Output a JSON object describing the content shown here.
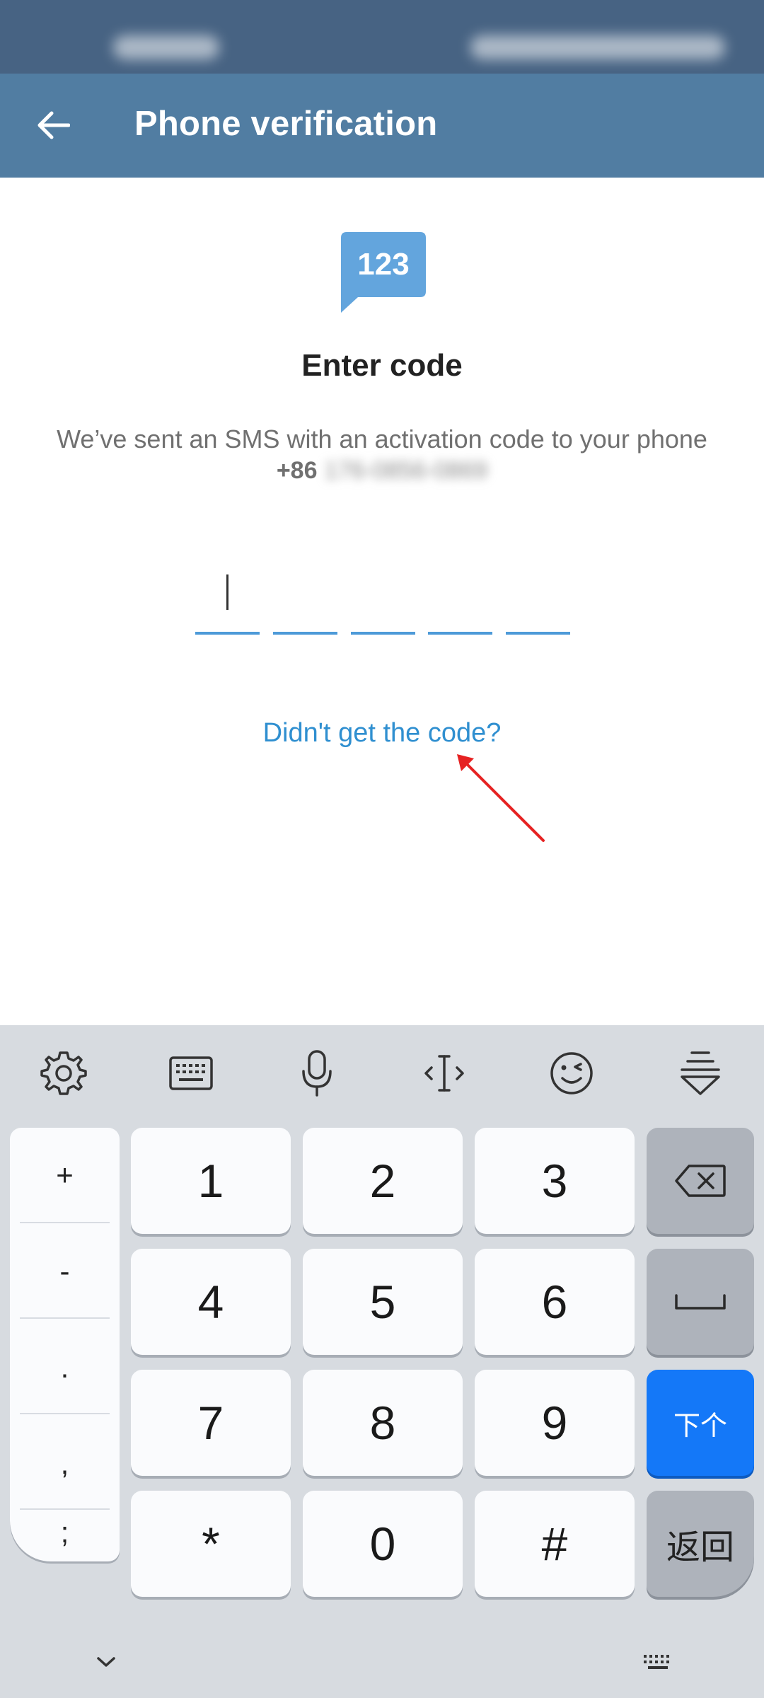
{
  "app_bar": {
    "title": "Phone verification",
    "back_icon": "arrow-left-icon",
    "background": "#517da2"
  },
  "status_bar": {
    "background": "#476383"
  },
  "content": {
    "code_icon_text": "123",
    "title": "Enter code",
    "description": "We’ve sent an SMS with an activation code to your phone",
    "phone_country_code": "+86",
    "phone_number": "176-0856-0869",
    "code_field_count": 5,
    "resend_link": "Didn't get the code?",
    "accent": "#2f8fd0"
  },
  "keyboard": {
    "toolbar_icons": [
      "settings-icon",
      "keyboard-icon",
      "microphone-icon",
      "cursor-move-icon",
      "emoji-icon",
      "hide-keyboard-icon"
    ],
    "symbols": [
      "+",
      "-",
      ".",
      ",",
      ";"
    ],
    "digits": [
      "1",
      "2",
      "3",
      "4",
      "5",
      "6",
      "7",
      "8",
      "9",
      "*",
      "0",
      "#"
    ],
    "next_label": "下个",
    "return_label": "返回",
    "next_color": "#1478f8"
  }
}
